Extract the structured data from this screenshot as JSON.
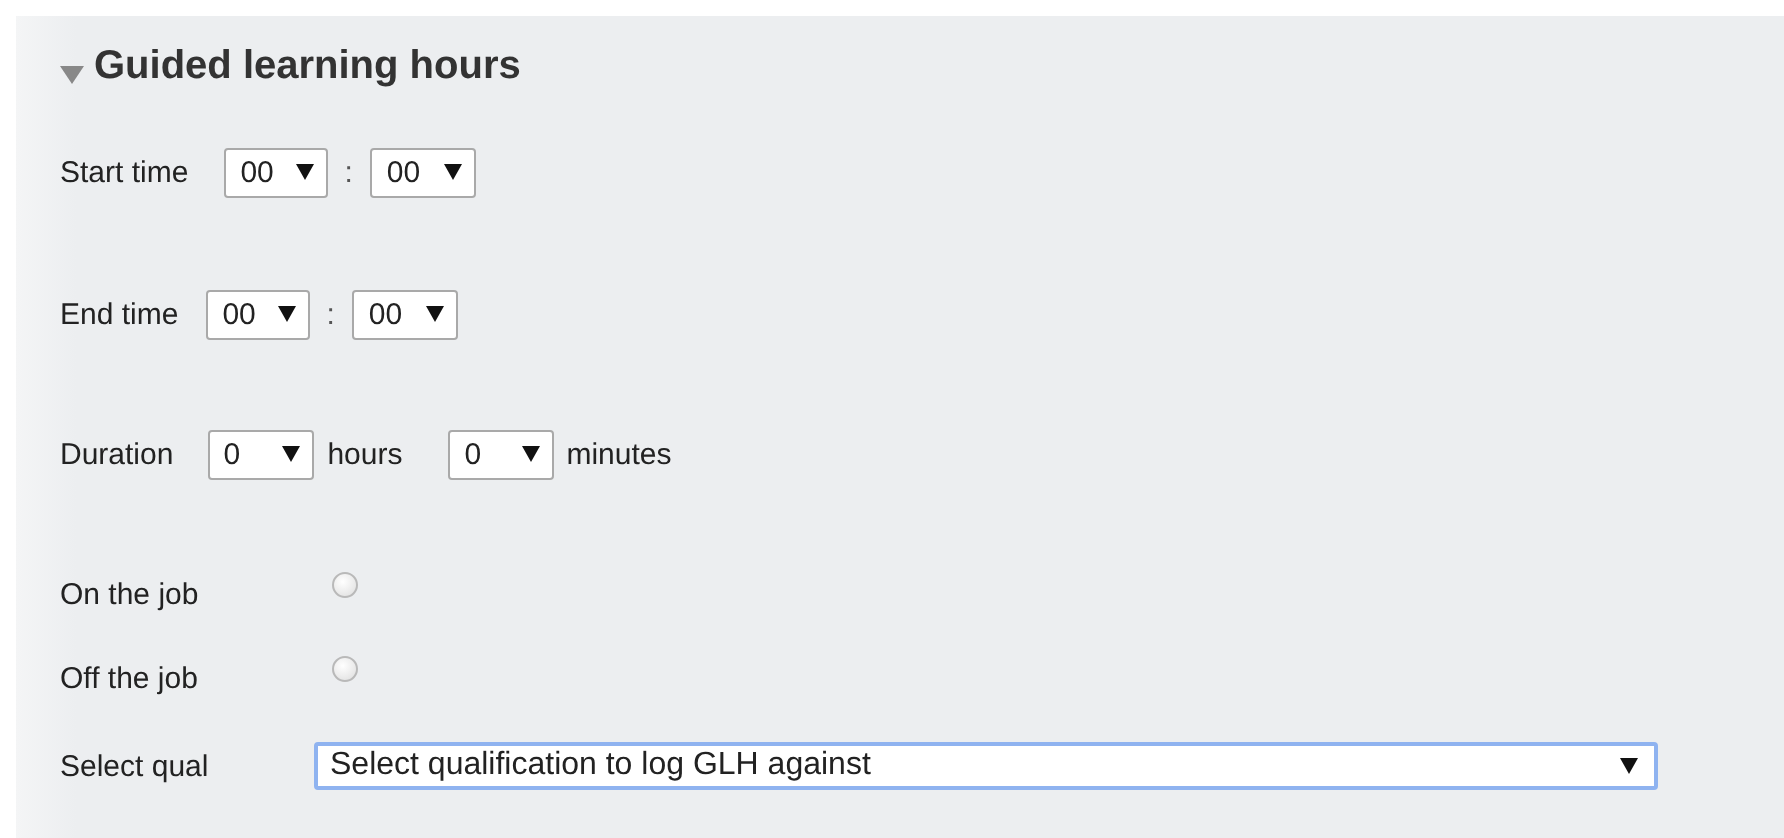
{
  "section": {
    "title": "Guided learning hours",
    "expanded": true
  },
  "start_time": {
    "label": "Start time",
    "hour": "00",
    "separator": ":",
    "minute": "00"
  },
  "end_time": {
    "label": "End time",
    "hour": "00",
    "separator": ":",
    "minute": "00"
  },
  "duration": {
    "label": "Duration",
    "hours": "0",
    "hours_unit": "hours",
    "minutes": "0",
    "minutes_unit": "minutes"
  },
  "placement": [
    {
      "label": "On the job",
      "selected": false
    },
    {
      "label": "Off the job",
      "selected": false
    }
  ],
  "qualification": {
    "label": "Select qual",
    "value": "Select qualification to log GLH against",
    "focused": true
  }
}
